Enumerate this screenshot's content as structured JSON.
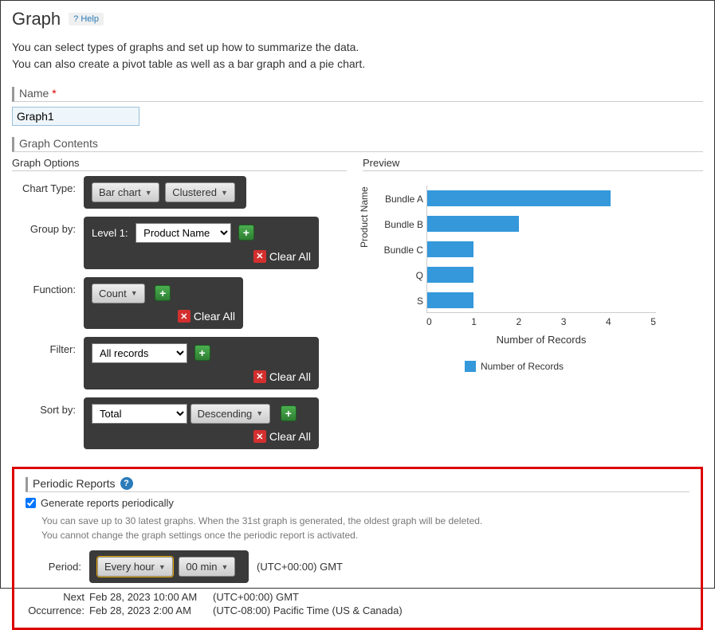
{
  "header": {
    "title": "Graph",
    "help": "Help"
  },
  "description": {
    "line1": "You can select types of graphs and set up how to summarize the data.",
    "line2": "You can also create a pivot table as well as a bar graph and a pie chart."
  },
  "name_section": {
    "label": "Name",
    "value": "Graph1"
  },
  "contents": {
    "header": "Graph Contents",
    "options_header": "Graph Options",
    "preview_header": "Preview",
    "chart_type": {
      "label": "Chart Type:",
      "main": "Bar chart",
      "sub": "Clustered"
    },
    "group_by": {
      "label": "Group by:",
      "level_label": "Level 1:",
      "value": "Product Name",
      "clear_all": "Clear All"
    },
    "function": {
      "label": "Function:",
      "value": "Count",
      "clear_all": "Clear All"
    },
    "filter": {
      "label": "Filter:",
      "value": "All records",
      "clear_all": "Clear All"
    },
    "sort_by": {
      "label": "Sort by:",
      "value": "Total",
      "order": "Descending",
      "clear_all": "Clear All"
    }
  },
  "chart_data": {
    "type": "bar",
    "orientation": "horizontal",
    "categories": [
      "Bundle A",
      "Bundle B",
      "Bundle C",
      "Q",
      "S"
    ],
    "values": [
      4,
      2,
      1,
      1,
      1
    ],
    "title": "",
    "xlabel": "Number of Records",
    "ylabel": "Product Name",
    "xlim": [
      0,
      5
    ],
    "legend": "Number of Records",
    "x_ticks": [
      "0",
      "1",
      "2",
      "3",
      "4",
      "5"
    ]
  },
  "periodic": {
    "header": "Periodic Reports",
    "checkbox_label": "Generate reports periodically",
    "note1": "You can save up to 30 latest graphs. When the 31st graph is generated, the oldest graph will be deleted.",
    "note2": "You cannot change the graph settings once the periodic report is activated.",
    "period_label": "Period:",
    "period_value": "Every hour",
    "minute_value": "00 min",
    "tz": "(UTC+00:00) GMT",
    "next_label": "Next Occurrence:",
    "next_label_top": "Next",
    "next_label_bottom": "Occurrence:",
    "row1_date": "Feb 28, 2023 10:00 AM",
    "row1_tz": "(UTC+00:00) GMT",
    "row2_date": "Feb 28, 2023 2:00 AM",
    "row2_tz": "(UTC-08:00) Pacific Time (US & Canada)"
  }
}
